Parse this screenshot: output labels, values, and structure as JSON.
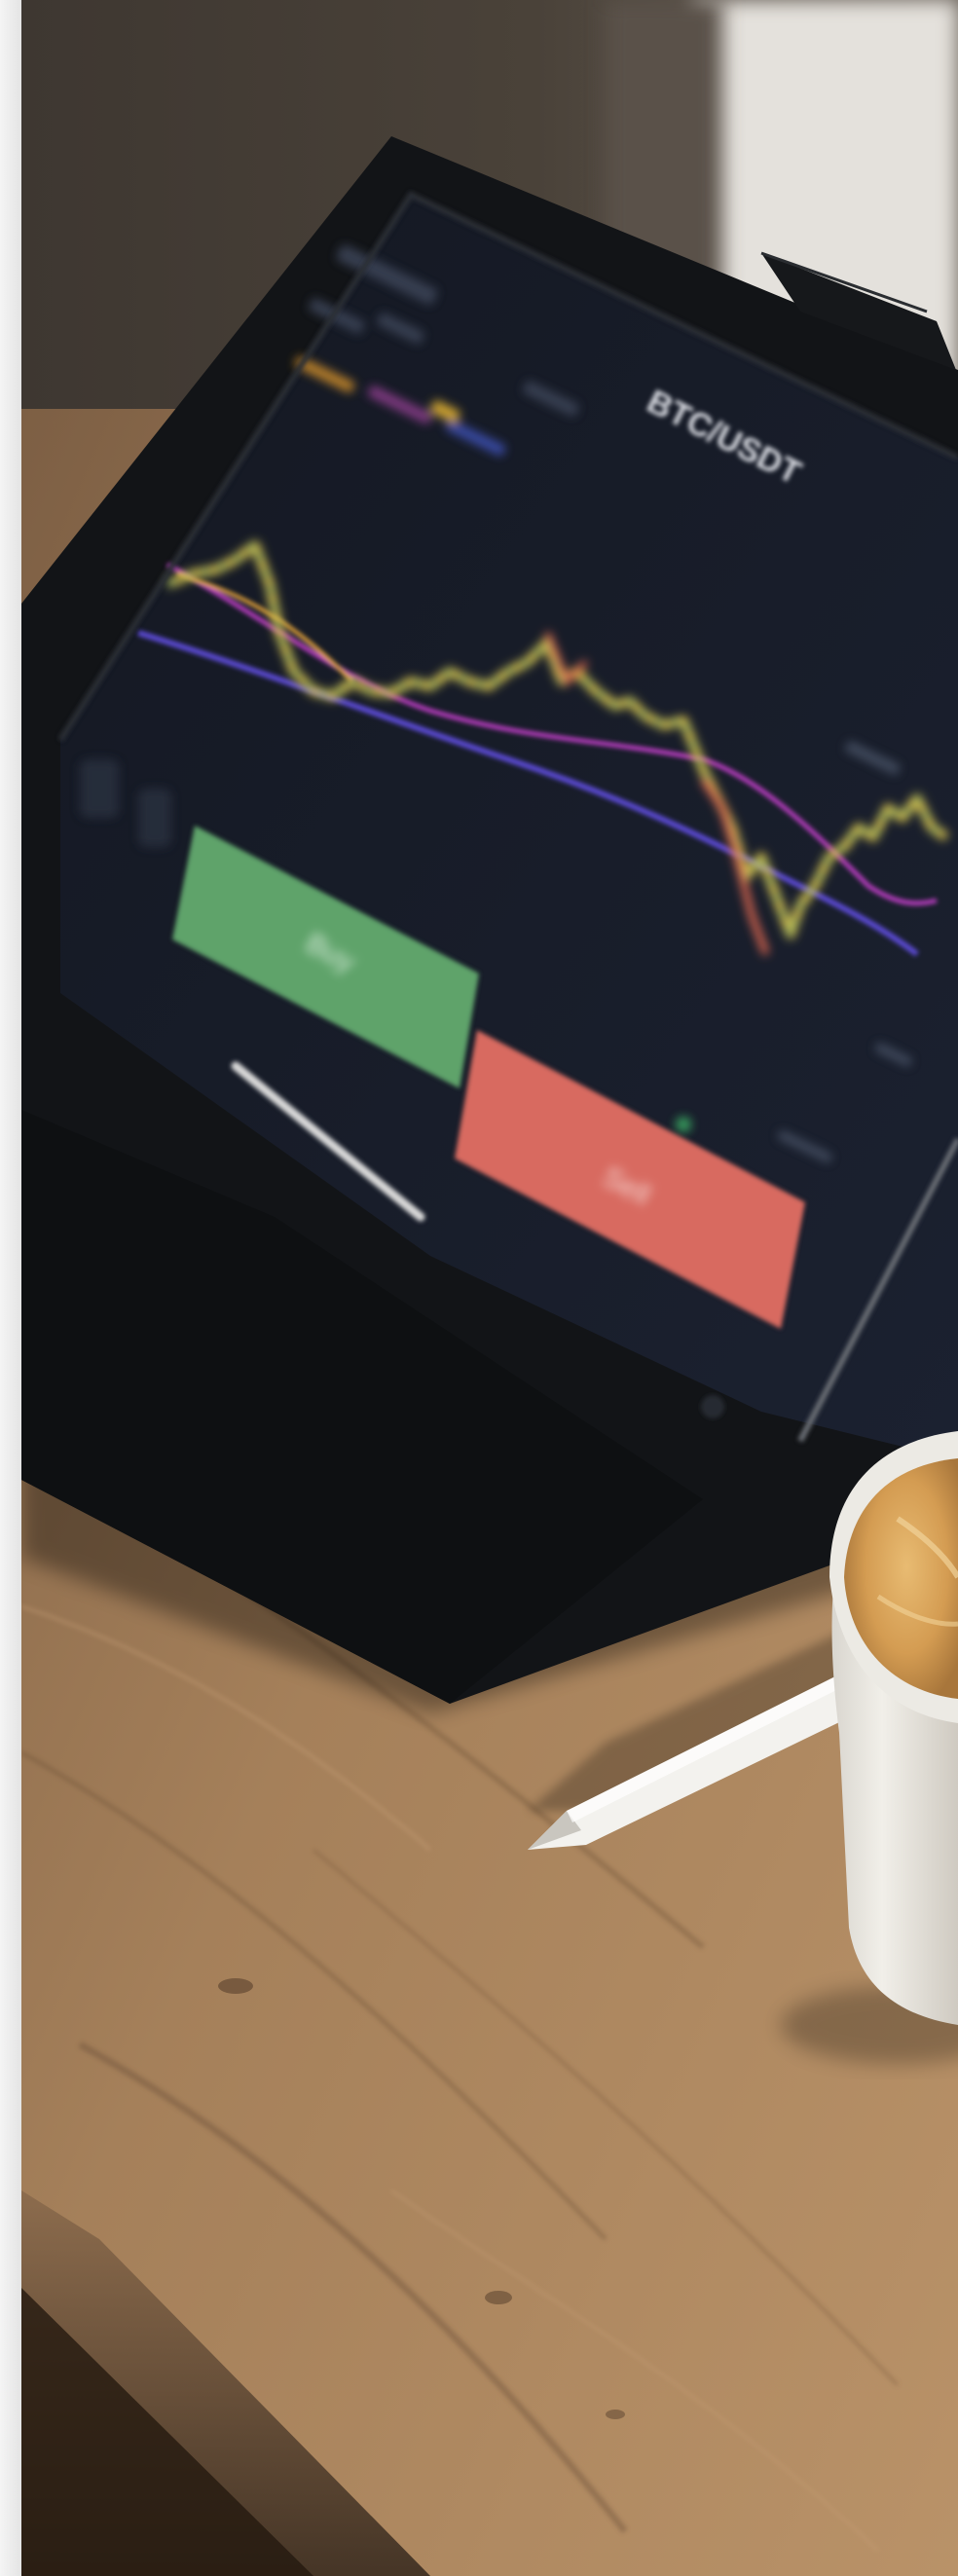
{
  "photo": {
    "scene": "tablet-trading-app-with-coffee-and-stylus",
    "tablet_screen": {
      "pair_label": "BTC/USDT",
      "buy_label": "Buy",
      "sell_label": "Sell"
    },
    "colors": {
      "wall": "#3a342e",
      "desk_wood": "#a5805a",
      "tablet_case": "#121417",
      "screen_bg": "#151a24",
      "buy_green": "#5fa36b",
      "sell_red": "#d86a61",
      "coffee_foam": "#d9a55e",
      "cup_white": "#eceae4"
    },
    "icons": [
      "stylus-pencil",
      "coffee-cup"
    ]
  }
}
